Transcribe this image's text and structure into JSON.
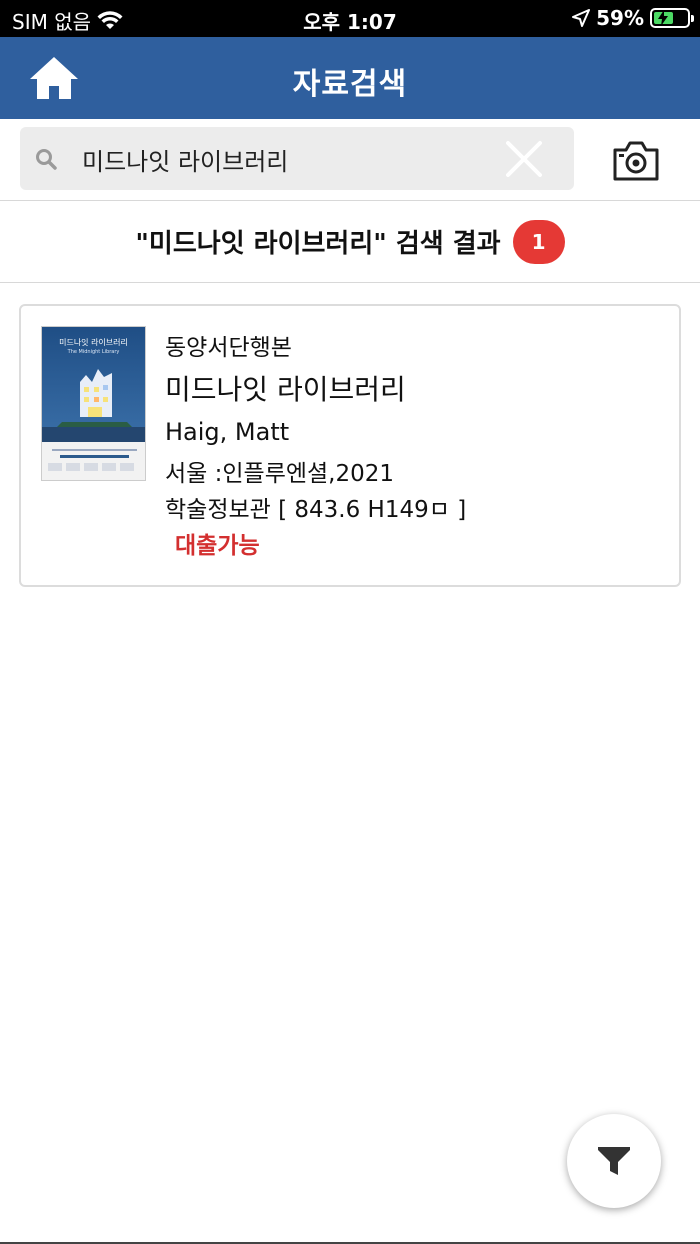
{
  "status_bar": {
    "carrier": "SIM 없음",
    "time": "오후 1:07",
    "battery_percent": "59%",
    "battery_level": 0.59
  },
  "header": {
    "title": "자료검색",
    "home_icon": "home-icon"
  },
  "search": {
    "value": "미드나잇 라이브러리",
    "search_icon": "search-icon",
    "clear_icon": "close-icon",
    "camera_icon": "camera-icon"
  },
  "results": {
    "title": "\"미드나잇 라이브러리\" 검색 결과",
    "count": "1",
    "items": [
      {
        "category": "동양서단행본",
        "title": "미드나잇 라이브러리",
        "author": "Haig, Matt",
        "publisher": "서울 :인플루엔셜,2021",
        "location": "학술정보관 [ 843.6 H149ㅁ ]",
        "status": "대출가능",
        "cover_title": "미드나잇 라이브러리",
        "cover_subtitle": "The Midnight Library"
      }
    ]
  },
  "filter": {
    "icon": "filter-icon"
  },
  "colors": {
    "header_bg": "#2f5f9e",
    "badge": "#e53935",
    "status_available": "#d32f2f"
  }
}
